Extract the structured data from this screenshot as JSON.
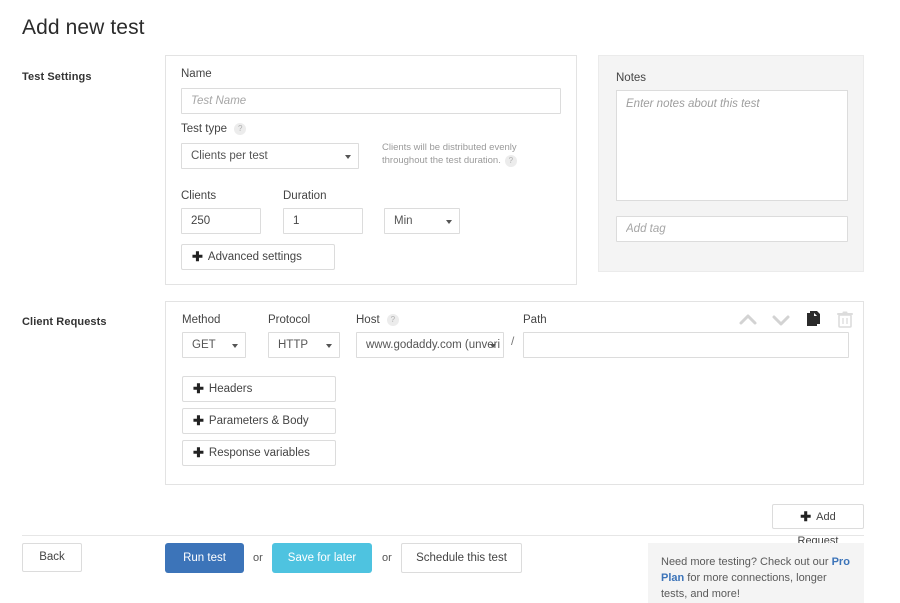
{
  "page": {
    "title": "Add new test"
  },
  "sections": {
    "test_settings_label": "Test Settings",
    "client_requests_label": "Client Requests"
  },
  "test_settings": {
    "name_label": "Name",
    "name_value": "",
    "name_placeholder": "Test Name",
    "test_type_label": "Test type",
    "test_type_help": "?",
    "test_type_value": "Clients per test",
    "hint_text": "Clients will be distributed evenly throughout the test duration.",
    "hint_help": "?",
    "clients_label": "Clients",
    "clients_value": "250",
    "duration_label": "Duration",
    "duration_value": "1",
    "duration_unit_value": "Min",
    "advanced_settings_label": "Advanced settings",
    "plus_glyph": "✚"
  },
  "notes": {
    "label": "Notes",
    "notes_value": "",
    "notes_placeholder": "Enter notes about this test",
    "tag_value": "",
    "tag_placeholder": "Add tag"
  },
  "client_request": {
    "method_label": "Method",
    "method_value": "GET",
    "protocol_label": "Protocol",
    "protocol_value": "HTTP",
    "host_label": "Host",
    "host_help": "?",
    "host_value": "www.godaddy.com (unveri",
    "path_separator": "/",
    "path_label": "Path",
    "path_value": "",
    "path_placeholder": "",
    "headers_label": "Headers",
    "parameters_body_label": "Parameters & Body",
    "response_variables_label": "Response variables",
    "plus_glyph": "✚",
    "icons": {
      "move_up": "chevron-up-icon",
      "move_down": "chevron-down-icon",
      "duplicate": "duplicate-icon",
      "delete": "trash-icon"
    }
  },
  "actions": {
    "add_request_label": "Add Request",
    "add_request_plus": "✚",
    "back_label": "Back",
    "run_test_label": "Run test",
    "save_for_later_label": "Save for later",
    "schedule_label": "Schedule this test",
    "or_label_1": "or",
    "or_label_2": "or"
  },
  "promo": {
    "text_before": "Need more testing? Check out our ",
    "link_text": "Pro Plan",
    "text_after": " for more connections, longer tests, and more!"
  },
  "colors": {
    "run_test_bg": "#3c74b9",
    "save_for_later_bg": "#4ec3e0",
    "link": "#3c74b9",
    "panel_border": "#e3e3e3",
    "notes_bg": "#f4f4f4"
  }
}
